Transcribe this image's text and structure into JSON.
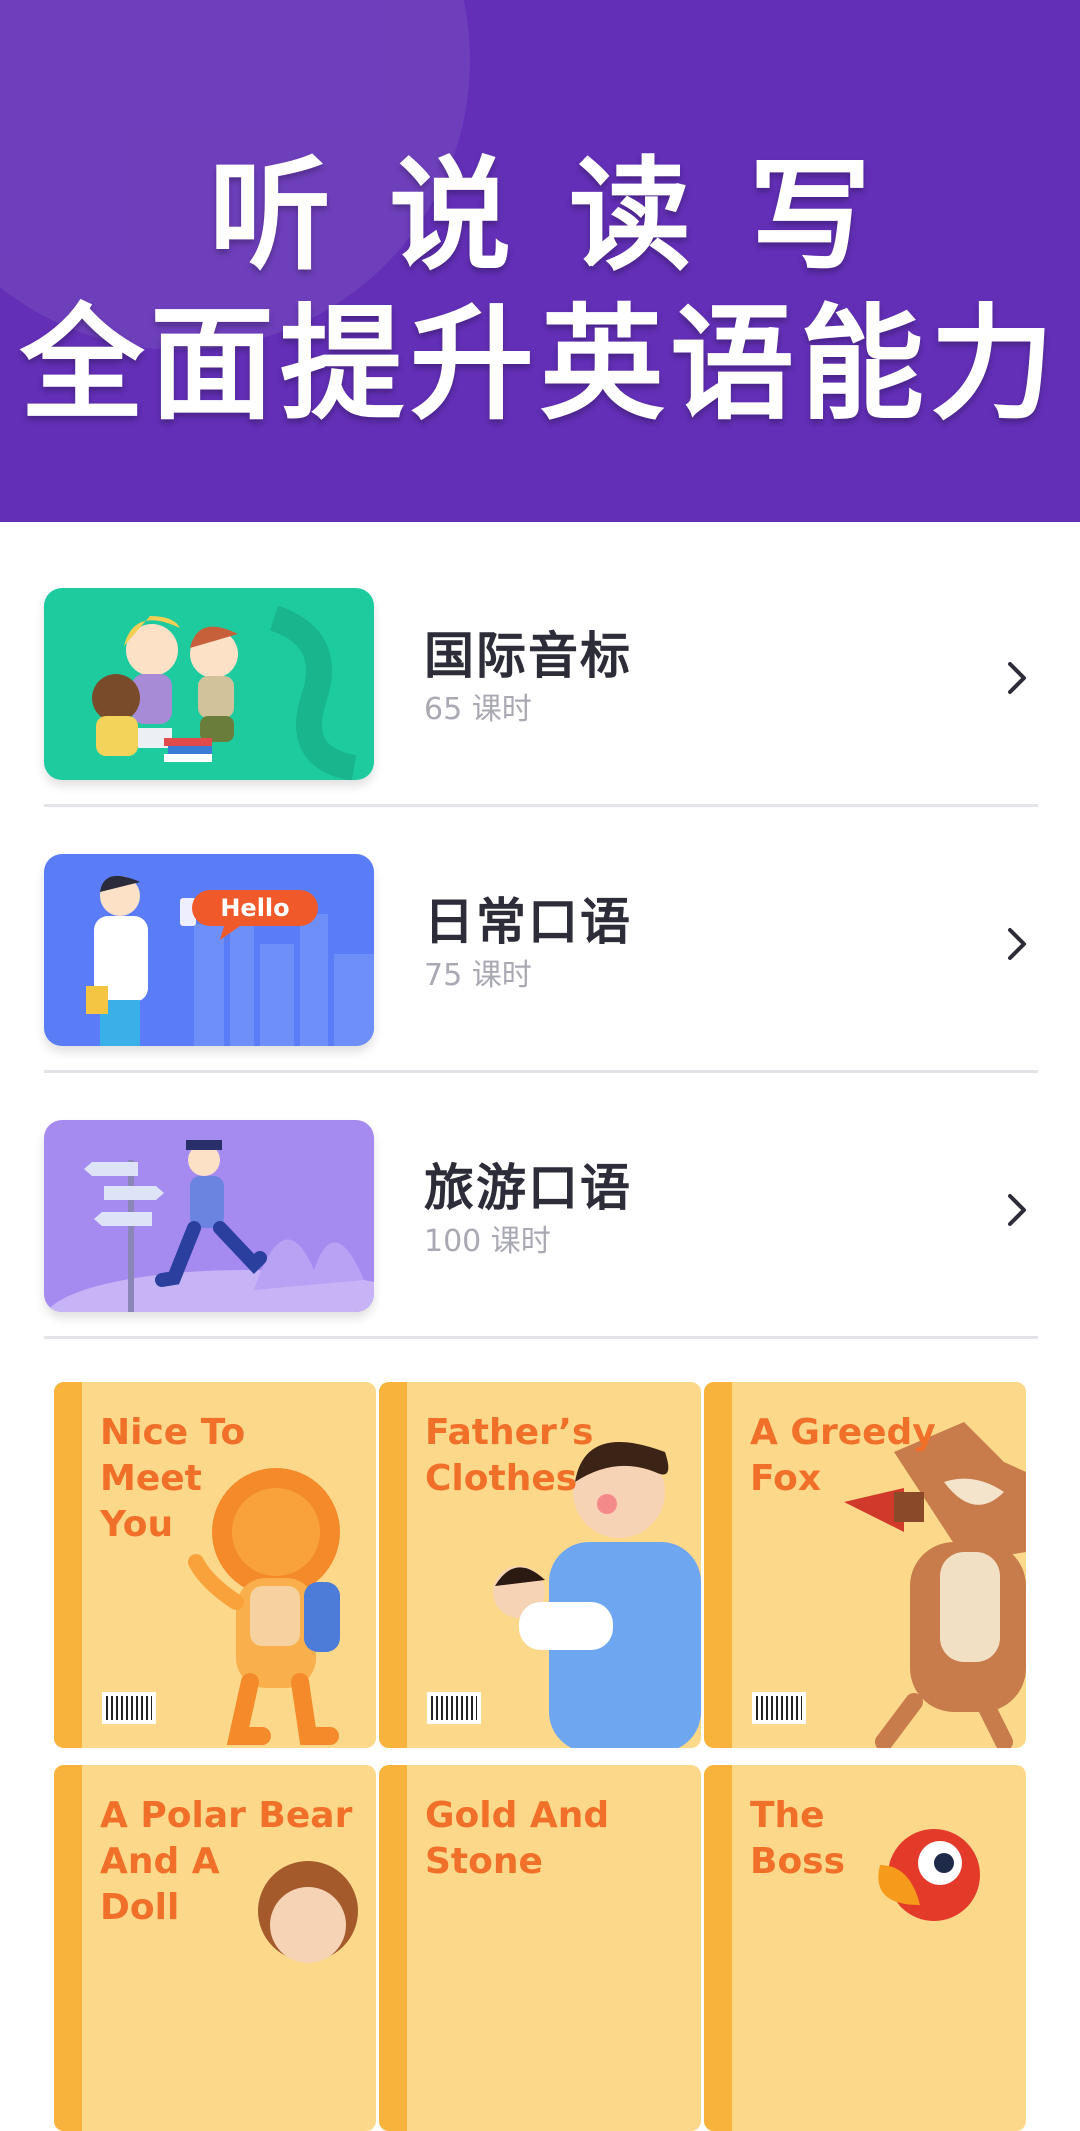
{
  "banner": {
    "line1": "听说读写",
    "line2": "全面提升英语能力",
    "background": "#622fb6"
  },
  "courses": [
    {
      "title": "国际音标",
      "subtitle": "65 课时",
      "thumb_color": "#1ecb9f"
    },
    {
      "title": "日常口语",
      "subtitle": "75 课时",
      "thumb_color": "#5a7cf6",
      "bubble_text": "Hello"
    },
    {
      "title": "旅游口语",
      "subtitle": "100 课时",
      "thumb_color": "#a58af0"
    }
  ],
  "books": [
    {
      "title": "Nice To\nMeet\nYou",
      "art": "lion-illustration"
    },
    {
      "title": "Father’s\nClothes",
      "art": "father-baby-illustration"
    },
    {
      "title": "A Greedy\nFox",
      "art": "fox-illustration"
    },
    {
      "title": "A Polar Bear\nAnd A\nDoll",
      "art": "girl-illustration"
    },
    {
      "title": "Gold And\nStone",
      "art": "gold-stone-illustration"
    },
    {
      "title": "The\nBoss",
      "art": "parrot-illustration"
    }
  ],
  "colors": {
    "book_bg": "#fcd98a",
    "book_spine": "#f7b33b",
    "book_title": "#f0702a",
    "divider": "#e4e4e8"
  }
}
